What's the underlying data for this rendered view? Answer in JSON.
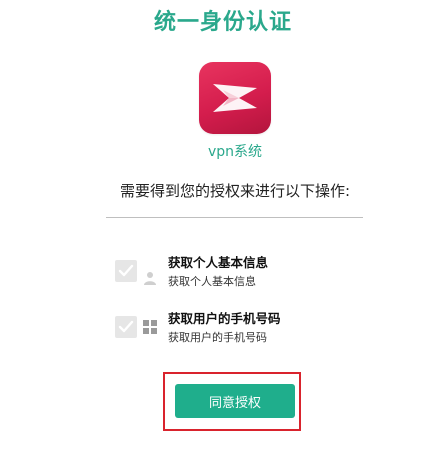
{
  "header": {
    "title": "统一身份认证"
  },
  "app": {
    "name": "vpn系统",
    "brand_color": "#d41d4d"
  },
  "prompt": {
    "text": "需要得到您的授权来进行以下操作:"
  },
  "permissions": [
    {
      "title": "获取个人基本信息",
      "description": "获取个人基本信息",
      "checked": true,
      "icon": "user-icon"
    },
    {
      "title": "获取用户的手机号码",
      "description": "获取用户的手机号码",
      "checked": true,
      "icon": "grid-icon"
    }
  ],
  "actions": {
    "authorize_label": "同意授权"
  },
  "colors": {
    "accent": "#2aa88c",
    "button": "#1fae8c",
    "highlight": "#d9232d"
  }
}
